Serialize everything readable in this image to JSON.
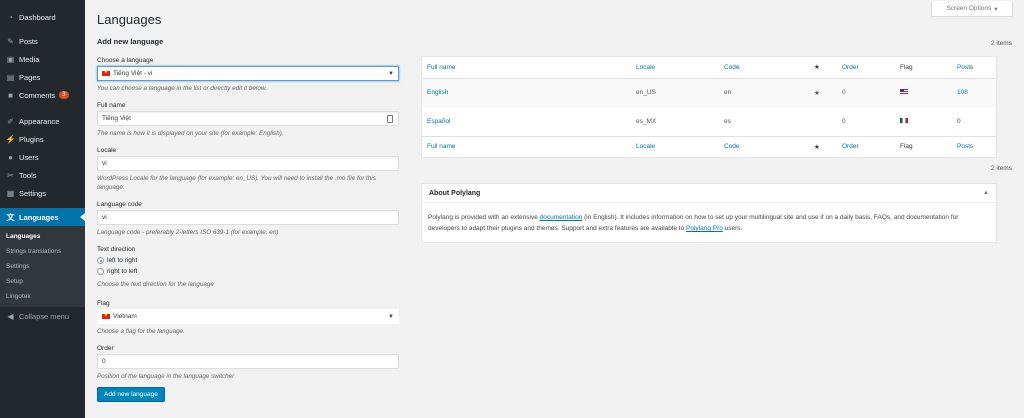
{
  "sidebar": {
    "dashboard": "Dashboard",
    "posts": "Posts",
    "media": "Media",
    "pages": "Pages",
    "comments": "Comments",
    "comments_badge": "3",
    "appearance": "Appearance",
    "plugins": "Plugins",
    "users": "Users",
    "tools": "Tools",
    "settings": "Settings",
    "languages": "Languages",
    "submenu": [
      "Languages",
      "Strings translations",
      "Settings",
      "Setup",
      "Lingotek"
    ],
    "collapse": "Collapse menu"
  },
  "screen_options": "Screen Options",
  "page_title": "Languages",
  "form": {
    "heading": "Add new language",
    "choose_label": "Choose a language",
    "choose_value": "Tiếng Việt - vi",
    "choose_help": "You can choose a language in the list or directly edit it below.",
    "fullname_label": "Full name",
    "fullname_value": "Tiếng Việt",
    "fullname_help": "The name is how it is displayed on your site (for example: English).",
    "locale_label": "Locale",
    "locale_value": "vi",
    "locale_help": "WordPress Locale for the language (for example: en_US). You will need to install the .mo file for this language.",
    "code_label": "Language code",
    "code_value": "vi",
    "code_help": "Language code - preferably 2-letters ISO 639-1 (for example: en)",
    "direction_label": "Text direction",
    "ltr": "left to right",
    "rtl": "right to left",
    "direction_help": "Choose the text direction for the language",
    "flag_label": "Flag",
    "flag_value": "Vietnam",
    "flag_help": "Choose a flag for the language.",
    "order_label": "Order",
    "order_value": "0",
    "order_help": "Position of the language in the language switcher",
    "submit": "Add new language"
  },
  "items_count": "2 items",
  "table": {
    "headers": [
      "Full name",
      "Locale",
      "Code",
      "★",
      "Order",
      "Flag",
      "Posts"
    ],
    "rows": [
      {
        "name": "English",
        "locale": "en_US",
        "code": "en",
        "default": "★",
        "order": "0",
        "flag": "us-flag-icon",
        "posts": "108"
      },
      {
        "name": "Español",
        "locale": "es_MX",
        "code": "es",
        "default": "",
        "order": "0",
        "flag": "mx-flag-icon",
        "posts": "0"
      }
    ]
  },
  "about": {
    "title": "About Polylang",
    "t1": "Polylang is provided with an extensive ",
    "link1": "documentation",
    "t2": " (in English). It includes information on how to set up your multilingual site and use it on a daily basis, FAQs, and documentation for developers to adapt their plugins and themes. Support and extra features are available to ",
    "link2": "Polylang Pro",
    "t3": " users."
  }
}
